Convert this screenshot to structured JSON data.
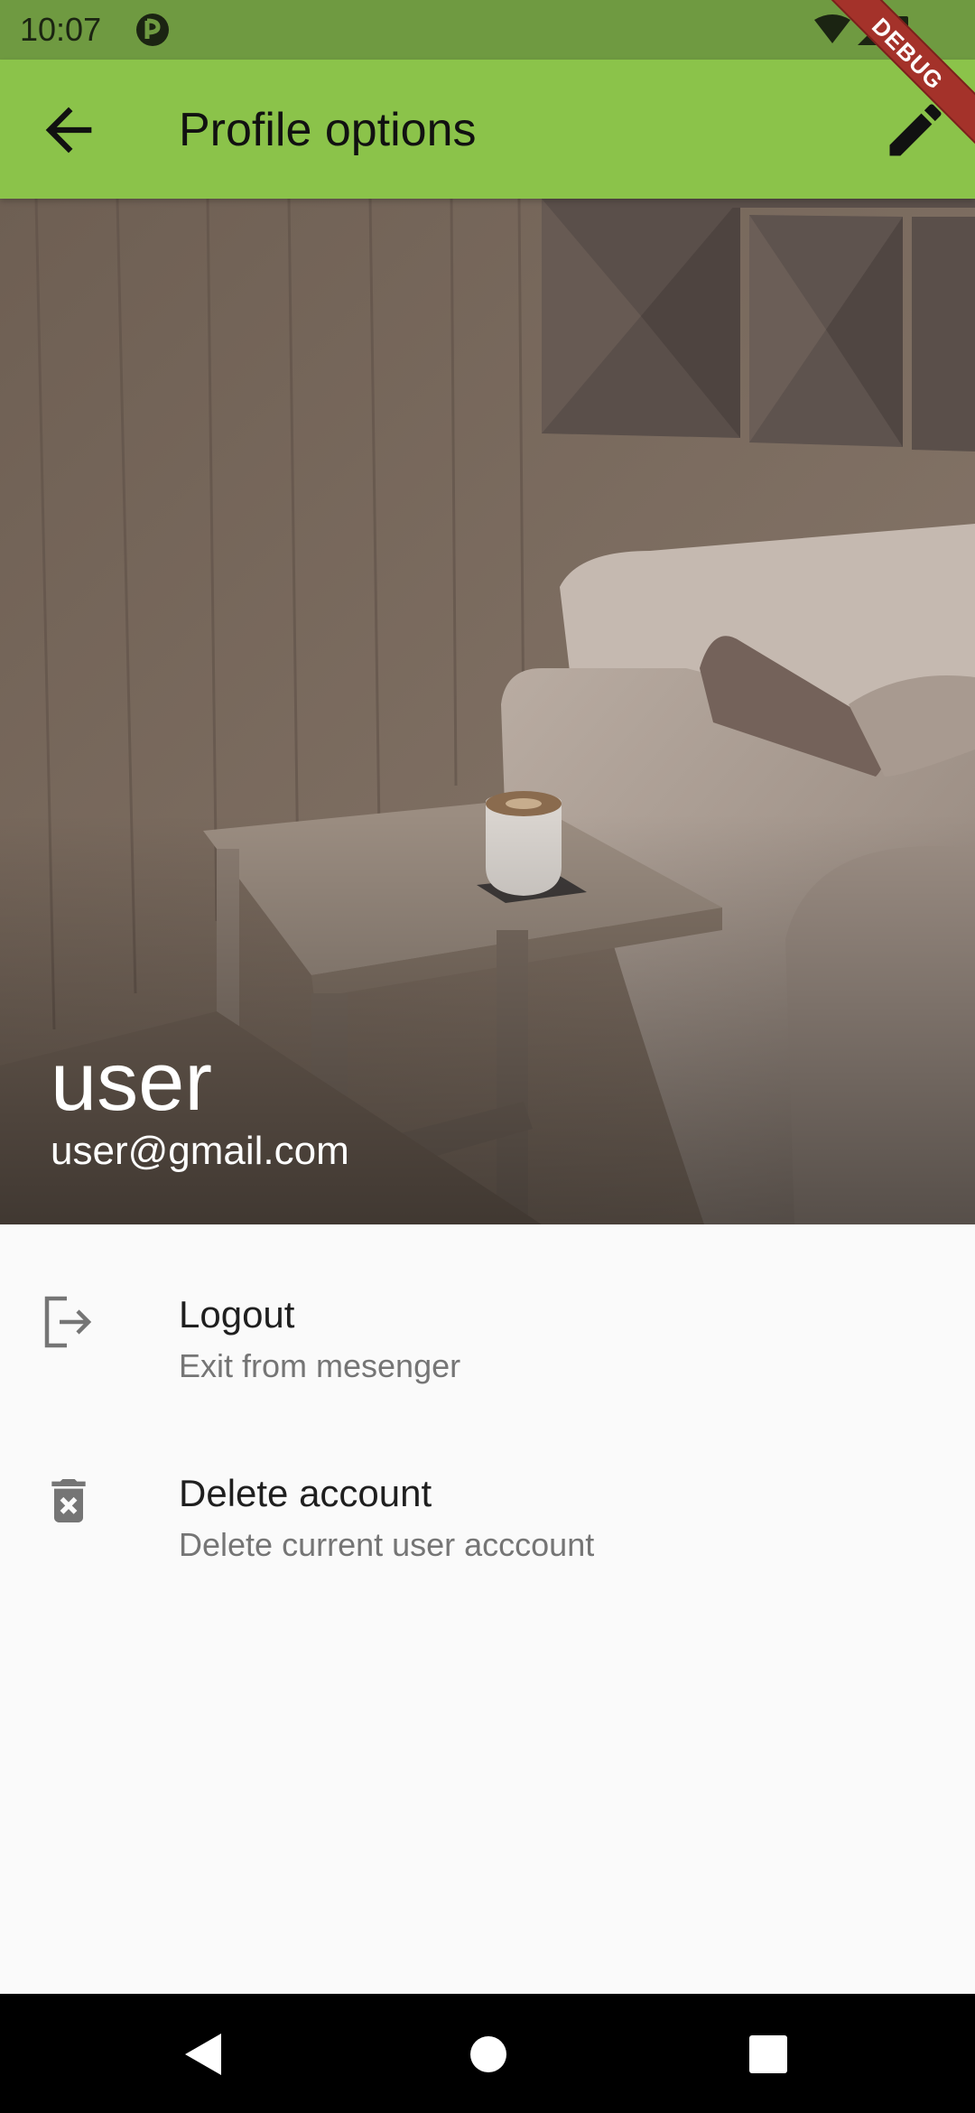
{
  "status_bar": {
    "time": "10:07",
    "debug_label": "DEBUG"
  },
  "app_bar": {
    "title": "Profile options",
    "back_icon": "arrow-back-icon",
    "edit_icon": "edit-pencil-icon",
    "color": "#8bc34a"
  },
  "profile": {
    "name": "user",
    "email": "user@gmail.com"
  },
  "options": [
    {
      "title": "Logout",
      "subtitle": "Exit from mesenger",
      "icon": "logout-icon"
    },
    {
      "title": "Delete account",
      "subtitle": "Delete current user acccount",
      "icon": "delete-forever-icon"
    }
  ],
  "nav_bar": {
    "buttons": [
      "back-triangle-icon",
      "home-circle-icon",
      "recents-square-icon"
    ]
  }
}
